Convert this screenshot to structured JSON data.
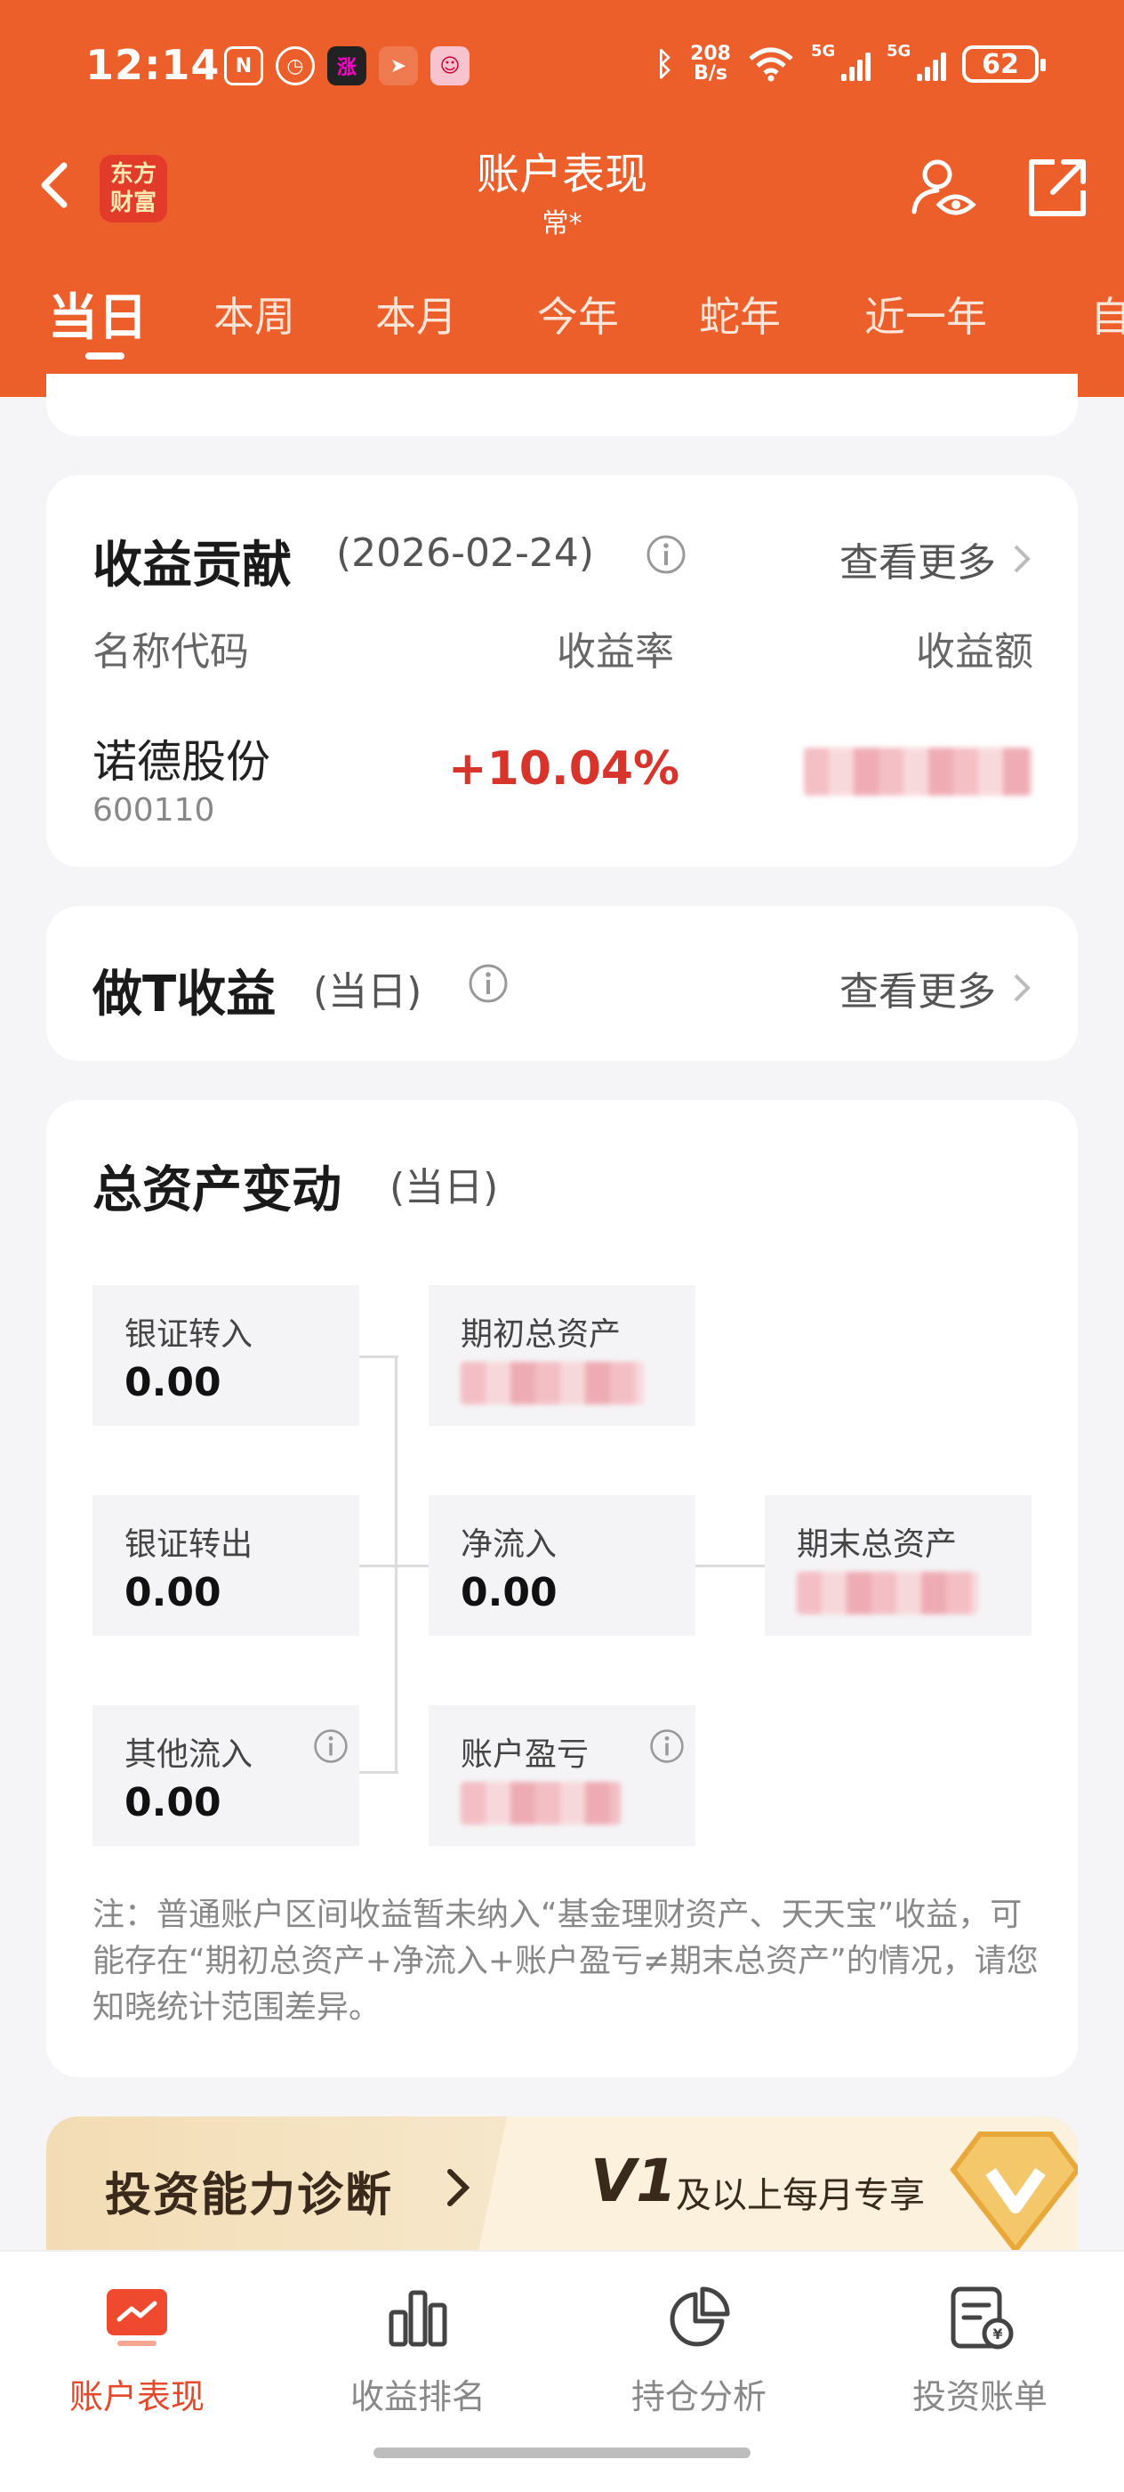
{
  "status_bar": {
    "time": "12:14",
    "net_speed_top": "208",
    "net_speed_bottom": "B/s",
    "signal_1": "5G",
    "signal_2": "5G",
    "battery": "62"
  },
  "header": {
    "logo_line1": "东方",
    "logo_line2": "财富",
    "title": "账户表现",
    "subtitle": "常*"
  },
  "tabs": [
    "当日",
    "本周",
    "本月",
    "今年",
    "蛇年",
    "近一年",
    "自"
  ],
  "contribution": {
    "title": "收益贡献",
    "date": "(2026-02-24)",
    "more": "查看更多",
    "col_name": "名称代码",
    "col_rate": "收益率",
    "col_amount": "收益额",
    "stock_name": "诺德股份",
    "stock_code": "600110",
    "stock_rate": "+10.04%"
  },
  "t_trade": {
    "title": "做T收益",
    "period": "(当日)",
    "more": "查看更多"
  },
  "asset_change": {
    "title": "总资产变动",
    "period": "(当日)",
    "bank_in_label": "银证转入",
    "bank_in_value": "0.00",
    "bank_out_label": "银证转出",
    "bank_out_value": "0.00",
    "other_in_label": "其他流入",
    "other_in_value": "0.00",
    "start_asset_label": "期初总资产",
    "net_inflow_label": "净流入",
    "net_inflow_value": "0.00",
    "pnl_label": "账户盈亏",
    "end_asset_label": "期末总资产",
    "note": "注：普通账户区间收益暂未纳入“基金理财资产、天天宝”收益，可能存在“期初总资产+净流入+账户盈亏≠期末总资产”的情况，请您知晓统计范围差异。"
  },
  "banner": {
    "left_text": "投资能力诊断",
    "level": "V1",
    "right_text": "及以上每月专享"
  },
  "bottom_nav": [
    "账户表现",
    "收益排名",
    "持仓分析",
    "投资账单"
  ],
  "colors": {
    "brand": "#ec5f2b",
    "positive": "#d8342c"
  }
}
